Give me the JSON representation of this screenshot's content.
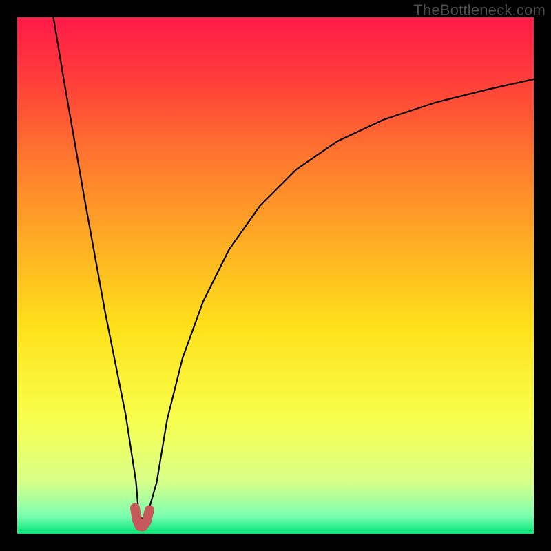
{
  "watermark": "TheBottleneck.com",
  "chart_data": {
    "type": "line",
    "title": "",
    "xlabel": "",
    "ylabel": "",
    "xlim": [
      0,
      100
    ],
    "ylim": [
      0,
      100
    ],
    "background": {
      "type": "vertical_gradient",
      "stops": [
        {
          "pos": 0.0,
          "color": "#ff1a47"
        },
        {
          "pos": 0.12,
          "color": "#ff3d3a"
        },
        {
          "pos": 0.28,
          "color": "#ff7a2e"
        },
        {
          "pos": 0.45,
          "color": "#ffb224"
        },
        {
          "pos": 0.6,
          "color": "#ffe11a"
        },
        {
          "pos": 0.78,
          "color": "#f7ff4d"
        },
        {
          "pos": 0.9,
          "color": "#d8ff8a"
        },
        {
          "pos": 0.965,
          "color": "#7dffb0"
        },
        {
          "pos": 1.0,
          "color": "#00e676"
        }
      ]
    },
    "series": [
      {
        "name": "bottleneck_curve",
        "stroke": "#000000",
        "stroke_width": 2.2,
        "x": [
          7,
          9,
          11,
          13,
          15,
          17,
          19,
          21,
          23,
          23.5,
          24,
          25,
          27,
          29,
          32,
          36,
          41,
          47,
          54,
          62,
          71,
          81,
          91,
          100
        ],
        "y": [
          100,
          88,
          76.5,
          65,
          54,
          43,
          33,
          23,
          10,
          4,
          3,
          3,
          10,
          22,
          34,
          45,
          55,
          63.5,
          70.5,
          76,
          80.2,
          83.5,
          86,
          88
        ]
      }
    ],
    "marker": {
      "name": "trough_marker",
      "color": "#c65a5a",
      "stroke_width": 14,
      "x": [
        22.8,
        23.2,
        23.7,
        24.3,
        25.0,
        25.6
      ],
      "y": [
        5.0,
        2.6,
        1.5,
        1.4,
        2.3,
        4.6
      ]
    }
  }
}
